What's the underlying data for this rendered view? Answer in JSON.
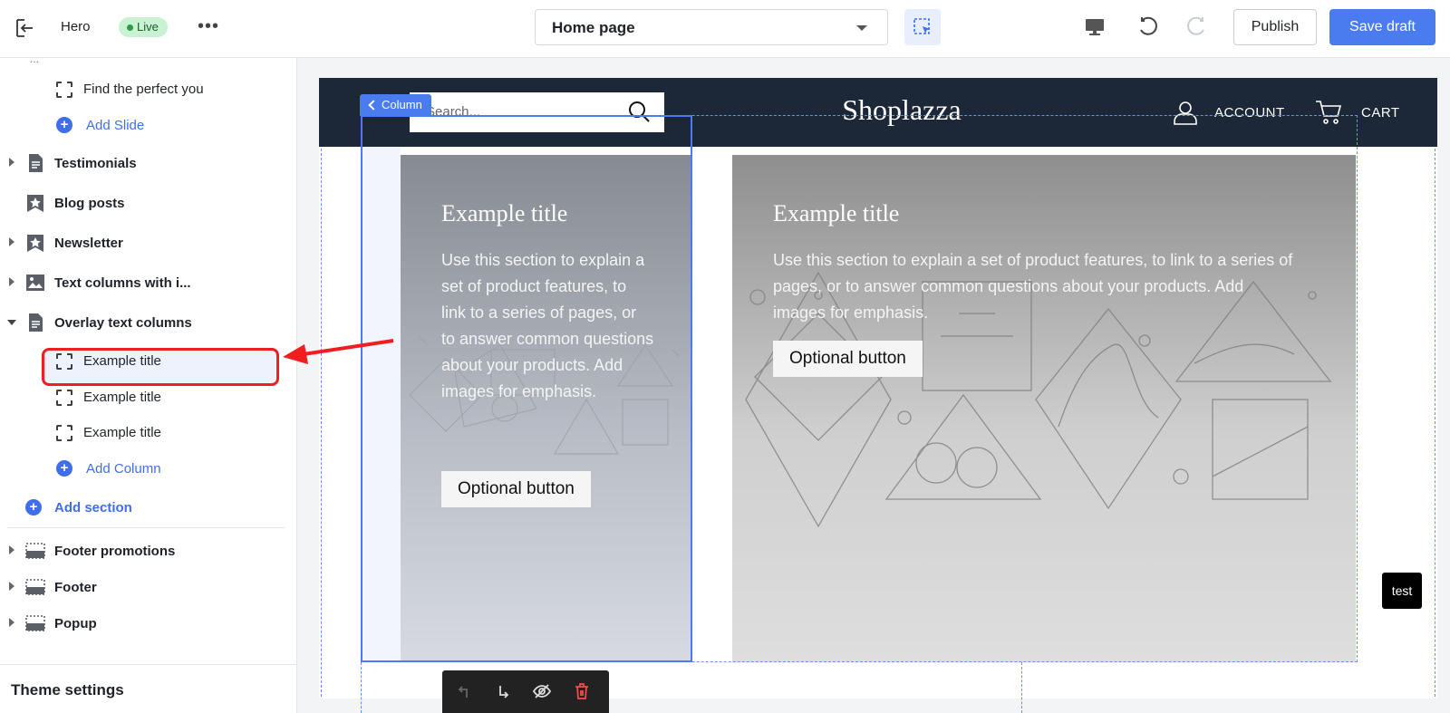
{
  "topbar": {
    "section_name": "Hero",
    "status_badge": "Live",
    "page_selector": "Home page",
    "publish_label": "Publish",
    "save_label": "Save draft",
    "icons": [
      "exit-icon",
      "more-icon",
      "select-tool-icon",
      "desktop-icon",
      "undo-icon",
      "redo-icon"
    ]
  },
  "sidebar": {
    "rows": [
      {
        "type": "block",
        "label": "Find the perfect you"
      },
      {
        "type": "add",
        "label": "Add Slide"
      },
      {
        "type": "section",
        "label": "Testimonials",
        "icon": "document-icon",
        "expanded": false
      },
      {
        "type": "section",
        "label": "Blog posts",
        "icon": "star-icon"
      },
      {
        "type": "section",
        "label": "Newsletter",
        "icon": "star-icon",
        "expanded": false
      },
      {
        "type": "section",
        "label": "Text columns with i...",
        "icon": "image-icon",
        "expanded": false
      },
      {
        "type": "section",
        "label": "Overlay text columns",
        "icon": "document-icon",
        "expanded": true
      },
      {
        "type": "block",
        "label": "Example title",
        "selected": true
      },
      {
        "type": "block",
        "label": "Example title"
      },
      {
        "type": "block",
        "label": "Example title"
      },
      {
        "type": "add",
        "label": "Add Column"
      },
      {
        "type": "add-section",
        "label": "Add section"
      },
      {
        "type": "section",
        "label": "Footer promotions",
        "icon": "layout-icon",
        "expanded": false
      },
      {
        "type": "section",
        "label": "Footer",
        "icon": "layout-icon",
        "expanded": false
      },
      {
        "type": "section",
        "label": "Popup",
        "icon": "layout-icon",
        "expanded": false
      }
    ],
    "theme_settings": "Theme settings"
  },
  "preview": {
    "search_placeholder": "Search...",
    "brand": "Shoplazza",
    "account_label": "ACCOUNT",
    "cart_label": "CART",
    "column_tag": "Column",
    "columns": [
      {
        "title": "Example title",
        "body": "Use this section to explain a set of product features, to link to a series of pages, or to answer common questions about your products. Add images for emphasis.",
        "button": "Optional button"
      },
      {
        "title": "Example title",
        "body": "Use this section to explain a set of product features, to link to a series of pages, or to answer common questions about your products. Add images for emphasis.",
        "button": "Optional button"
      }
    ],
    "floating_toolbar": [
      "move-up-icon",
      "move-down-icon",
      "hide-icon",
      "delete-icon"
    ],
    "test_badge": "test"
  },
  "colors": {
    "accent": "#4a7cf0",
    "header_bg": "#1c2837",
    "live_badge_bg": "#c8f2d2",
    "annotation_red": "#f01e1e"
  }
}
